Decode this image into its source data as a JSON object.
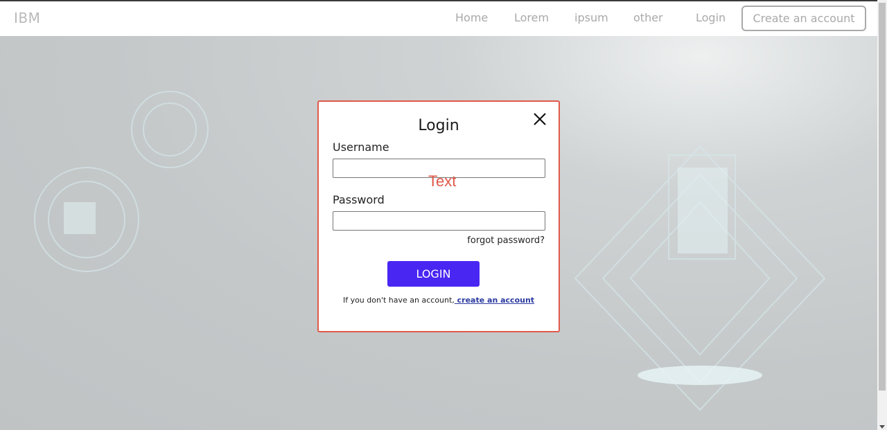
{
  "navbar": {
    "brand": "IBM",
    "links": [
      "Home",
      "Lorem",
      "ipsum",
      "other",
      "Login"
    ],
    "cta_label": "Create an account"
  },
  "modal": {
    "title": "Login",
    "close_icon": "close-icon",
    "username_label": "Username",
    "username_value": "",
    "password_label": "Password",
    "password_value": "",
    "overlay_text": "Text",
    "forgot_label": "forgot password?",
    "login_button_label": "LOGIN",
    "signup_prompt": "If you don't have an account,",
    "signup_link_label": " create an account"
  },
  "colors": {
    "accent": "#4a26f3",
    "modal_border": "#e0594a",
    "nav_text": "#a9a9a9"
  }
}
